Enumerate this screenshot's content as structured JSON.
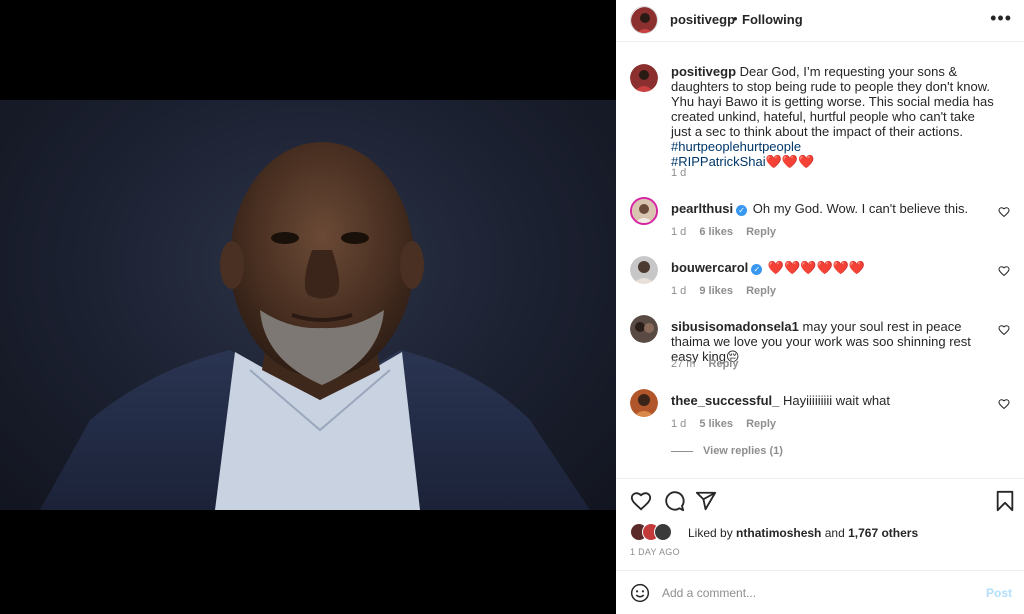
{
  "post": {
    "username": "positivegp",
    "separator": "•",
    "follow_status": "Following",
    "more_icon": "more-horizontal-icon",
    "caption": {
      "username": "positivegp",
      "text": "Dear God, I’m requesting your sons & daughters to stop being rude to people they don't know. Yhu hayi Bawo it is getting worse. This social media has created unkind, hateful, hurtful people who can't take just a sec to think about the impact of their actions.",
      "hashtag1": "#hurtpeoplehurtpeople",
      "hashtag2": "#RIPPatrickShai",
      "emojis": "❤️❤️❤️",
      "time": "1 d"
    }
  },
  "comments": [
    {
      "username": "pearlthusi",
      "verified": true,
      "text": "Oh my God. Wow. I can't believe this.",
      "time": "1 d",
      "likes": "6 likes",
      "reply": "Reply"
    },
    {
      "username": "bouwercarol",
      "verified": true,
      "text": "❤️❤️❤️❤️❤️❤️",
      "time": "1 d",
      "likes": "9 likes",
      "reply": "Reply"
    },
    {
      "username": "sibusisomadonsela1",
      "verified": false,
      "text": "may your soul rest in peace thaima we love you your work was soo shinning rest easy king😔",
      "time": "27 m",
      "likes": "",
      "reply": "Reply"
    },
    {
      "username": "thee_successful_",
      "verified": false,
      "text": "Hayiiiiiiiii wait what",
      "time": "1 d",
      "likes": "5 likes",
      "reply": "Reply"
    }
  ],
  "view_replies": "View replies (1)",
  "actions": {
    "icons": [
      "heart-icon",
      "comment-icon",
      "share-icon",
      "bookmark-icon"
    ],
    "liked_by_prefix": "Liked by",
    "liked_by_user": "nthatimoshesh",
    "and": "and",
    "others": "1,767 others",
    "date": "1 DAY AGO"
  },
  "add_comment": {
    "placeholder": "Add a comment...",
    "post_label": "Post"
  },
  "colors": {
    "accent": "#0095f6",
    "post_disabled": "#b2dffc",
    "secondary_text": "#8e8e8e",
    "hashtag": "#00376b",
    "verified": "#3897f0"
  }
}
